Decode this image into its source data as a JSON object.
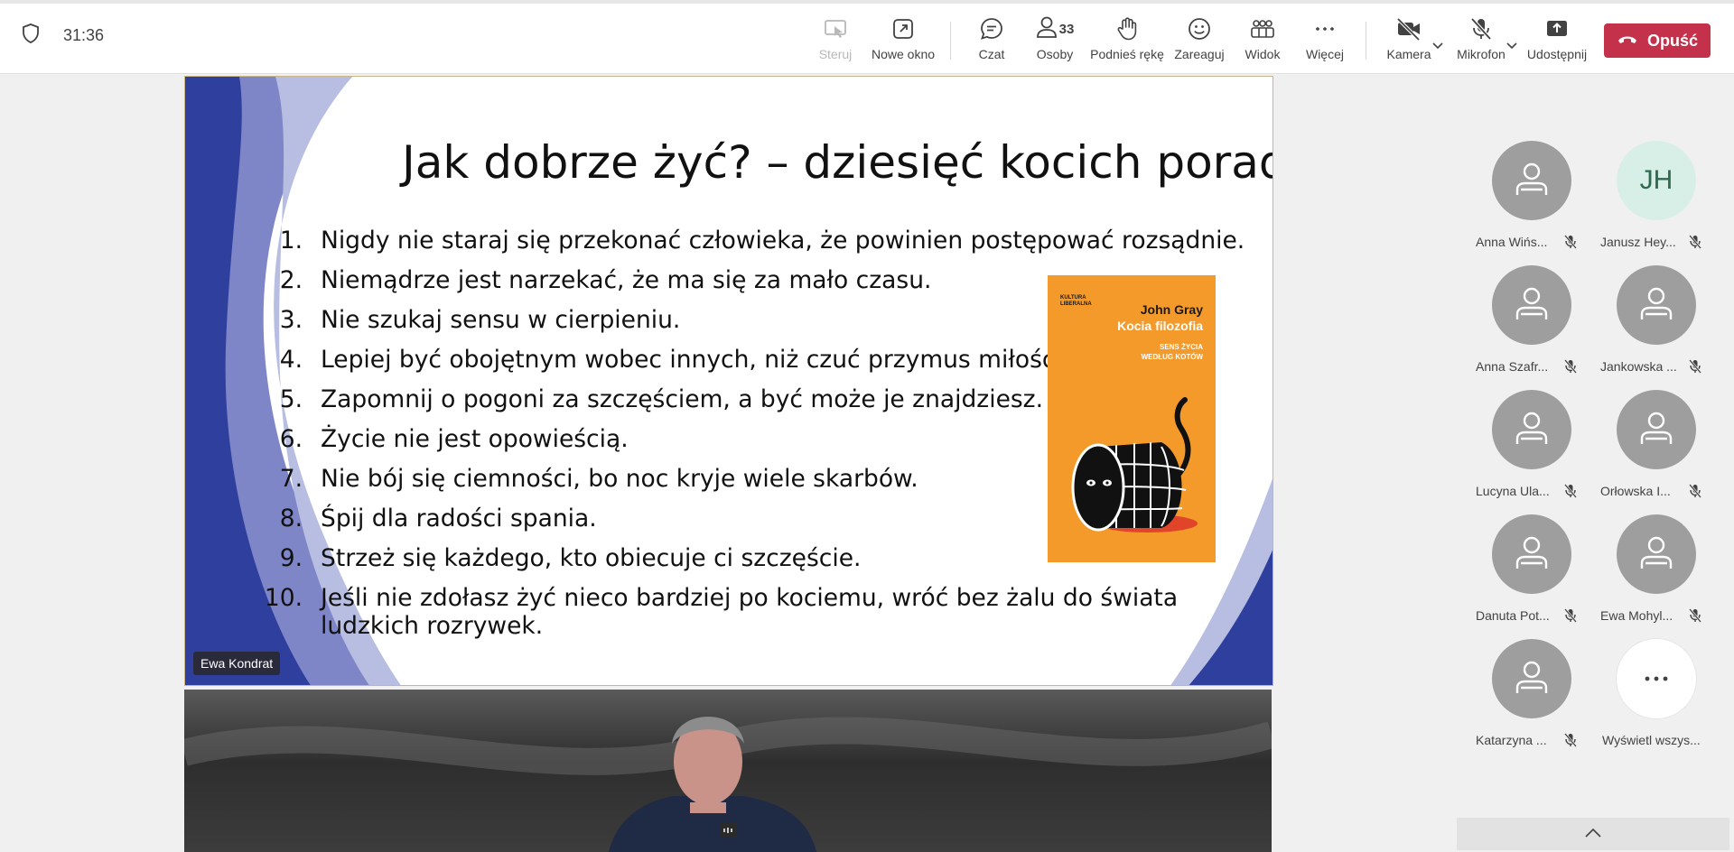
{
  "header": {
    "timer": "31:36",
    "buttons": {
      "steruj": "Steruj",
      "nowe_okno": "Nowe okno",
      "czat": "Czat",
      "osoby": "Osoby",
      "osoby_count": "33",
      "podnies": "Podnieś rękę",
      "zareaguj": "Zareaguj",
      "widok": "Widok",
      "wiecej": "Więcej",
      "kamera": "Kamera",
      "mikrofon": "Mikrofon",
      "udostepnij": "Udostępnij"
    },
    "leave_label": "Opuść",
    "leave_color": "#c4314b"
  },
  "slide": {
    "title": "Jak dobrze żyć? – dziesięć kocich porad",
    "tips": [
      {
        "num": "1.",
        "text": "Nigdy nie staraj się przekonać człowieka, że powinien postępować rozsądnie."
      },
      {
        "num": "2.",
        "text": "Niemądrze jest narzekać, że ma się za mało czasu."
      },
      {
        "num": "3.",
        "text": "Nie szukaj sensu w cierpieniu."
      },
      {
        "num": "4.",
        "text": "Lepiej być obojętnym wobec innych, niż czuć przymus miłości."
      },
      {
        "num": "5.",
        "text": "Zapomnij o pogoni za szczęściem, a być może je znajdziesz."
      },
      {
        "num": "6.",
        "text": "Życie nie jest opowieścią."
      },
      {
        "num": "7.",
        "text": "Nie bój się ciemności, bo noc kryje wiele skarbów."
      },
      {
        "num": "8.",
        "text": "Śpij dla radości spania."
      },
      {
        "num": "9.",
        "text": "Strzeż się każdego, kto obiecuje ci szczęście."
      },
      {
        "num": "10.",
        "text": "Jeśli nie zdołasz żyć nieco bardziej po kociemu, wróć bez żalu do świata ludzkich rozrywek."
      }
    ],
    "book": {
      "publisher": "KULTURA LIBERALNA",
      "author": "John Gray",
      "title": "Kocia filozofia",
      "subtitle": "SENS ŻYCIA WEDŁUG KOTÓW",
      "cover_color": "#f39a2b"
    },
    "presenter": "Ewa Kondrat",
    "accent_color": "#2e3f9e"
  },
  "participants": [
    {
      "name": "Anna Wińs...",
      "initials": ""
    },
    {
      "name": "Janusz Hey...",
      "initials": "JH"
    },
    {
      "name": "Anna Szafr...",
      "initials": ""
    },
    {
      "name": "Jankowska ...",
      "initials": ""
    },
    {
      "name": "Lucyna Ula...",
      "initials": ""
    },
    {
      "name": "Orłowska I...",
      "initials": ""
    },
    {
      "name": "Danuta Pot...",
      "initials": ""
    },
    {
      "name": "Ewa Mohyl...",
      "initials": ""
    },
    {
      "name": "Katarzyna ...",
      "initials": ""
    }
  ],
  "show_all_label": "Wyświetl wszys..."
}
